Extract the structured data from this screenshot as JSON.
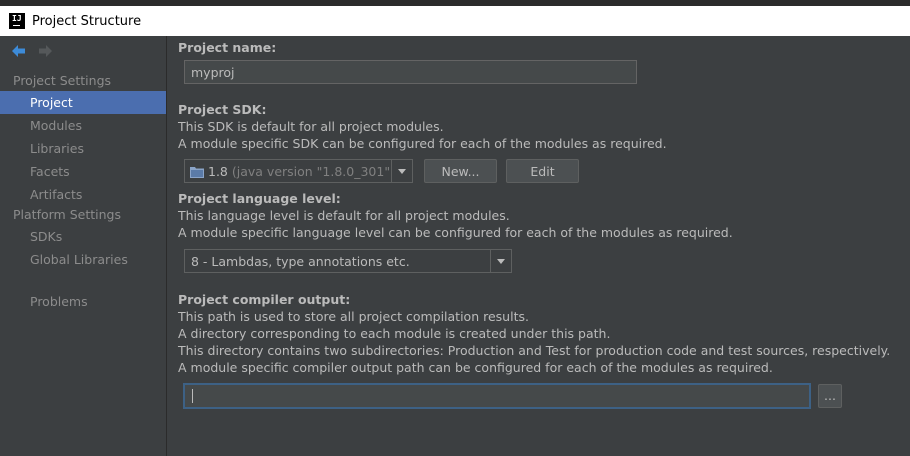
{
  "window": {
    "title": "Project Structure"
  },
  "sidebar": {
    "project_settings_title": "Project Settings",
    "project_settings_items": [
      {
        "label": "Project",
        "selected": true
      },
      {
        "label": "Modules"
      },
      {
        "label": "Libraries"
      },
      {
        "label": "Facets"
      },
      {
        "label": "Artifacts"
      }
    ],
    "platform_settings_title": "Platform Settings",
    "platform_settings_items": [
      {
        "label": "SDKs"
      },
      {
        "label": "Global Libraries"
      }
    ],
    "problems_label": "Problems"
  },
  "main": {
    "project_name": {
      "label": "Project name:",
      "value": "myproj"
    },
    "sdk": {
      "label": "Project SDK:",
      "desc1": "This SDK is default for all project modules.",
      "desc2": "A module specific SDK can be configured for each of the modules as required.",
      "selected_version": "1.8",
      "selected_detail": "(java version \"1.8.0_301\")",
      "new_button": "New...",
      "edit_button": "Edit"
    },
    "language_level": {
      "label": "Project language level:",
      "desc1": "This language level is default for all project modules.",
      "desc2": "A module specific language level can be configured for each of the modules as required.",
      "selected": "8 - Lambdas, type annotations etc."
    },
    "compiler_output": {
      "label": "Project compiler output:",
      "desc1": "This path is used to store all project compilation results.",
      "desc2": "A directory corresponding to each module is created under this path.",
      "desc3": "This directory contains two subdirectories: Production and Test for production code and test sources, respectively.",
      "desc4": "A module specific compiler output path can be configured for each of the modules as required.",
      "value": "",
      "browse_button": "..."
    }
  },
  "colors": {
    "background": "#3c3f41",
    "selection": "#4b6eaf",
    "focus_border": "#3d6185",
    "accent_arrow": "#3d8bd8"
  }
}
